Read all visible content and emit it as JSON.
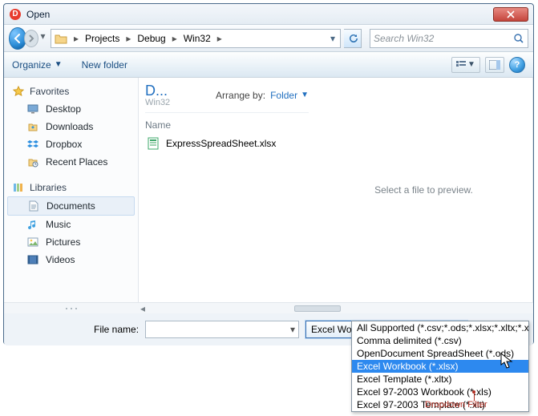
{
  "window": {
    "title": "Open"
  },
  "nav": {
    "crumbs": [
      "Projects",
      "Debug",
      "Win32"
    ],
    "search_placeholder": "Search Win32"
  },
  "cmd": {
    "organize": "Organize",
    "newfolder": "New folder",
    "help": "?"
  },
  "tree": {
    "fav_header": "Favorites",
    "fav_items": [
      "Desktop",
      "Downloads",
      "Dropbox",
      "Recent Places"
    ],
    "lib_header": "Libraries",
    "lib_items": [
      "Documents",
      "Music",
      "Pictures",
      "Videos"
    ],
    "selected": "Documents"
  },
  "content": {
    "heading": "D...",
    "subheading": "Win32",
    "arrange_label": "Arrange by:",
    "arrange_value": "Folder",
    "col_name": "Name",
    "files": [
      "ExpressSpreadSheet.xlsx"
    ]
  },
  "preview": {
    "empty_text": "Select a file to preview."
  },
  "filebar": {
    "label": "File name:",
    "filter_selected": "Excel Workbook (*.xlsx)"
  },
  "filter_options": [
    "All Supported (*.csv;*.ods;*.xlsx;*.xltx;*.xls;*.xlt;)",
    "Comma delimited (*.csv)",
    "OpenDocument SpreadSheet (*.ods)",
    "Excel Workbook (*.xlsx)",
    "Excel Template (*.xltx)",
    "Excel 97-2003 Workbook (*.xls)",
    "Excel 97-2003 Template (*.xlt)"
  ],
  "filter_selected_index": 3,
  "callout": "Dropdown Filter"
}
